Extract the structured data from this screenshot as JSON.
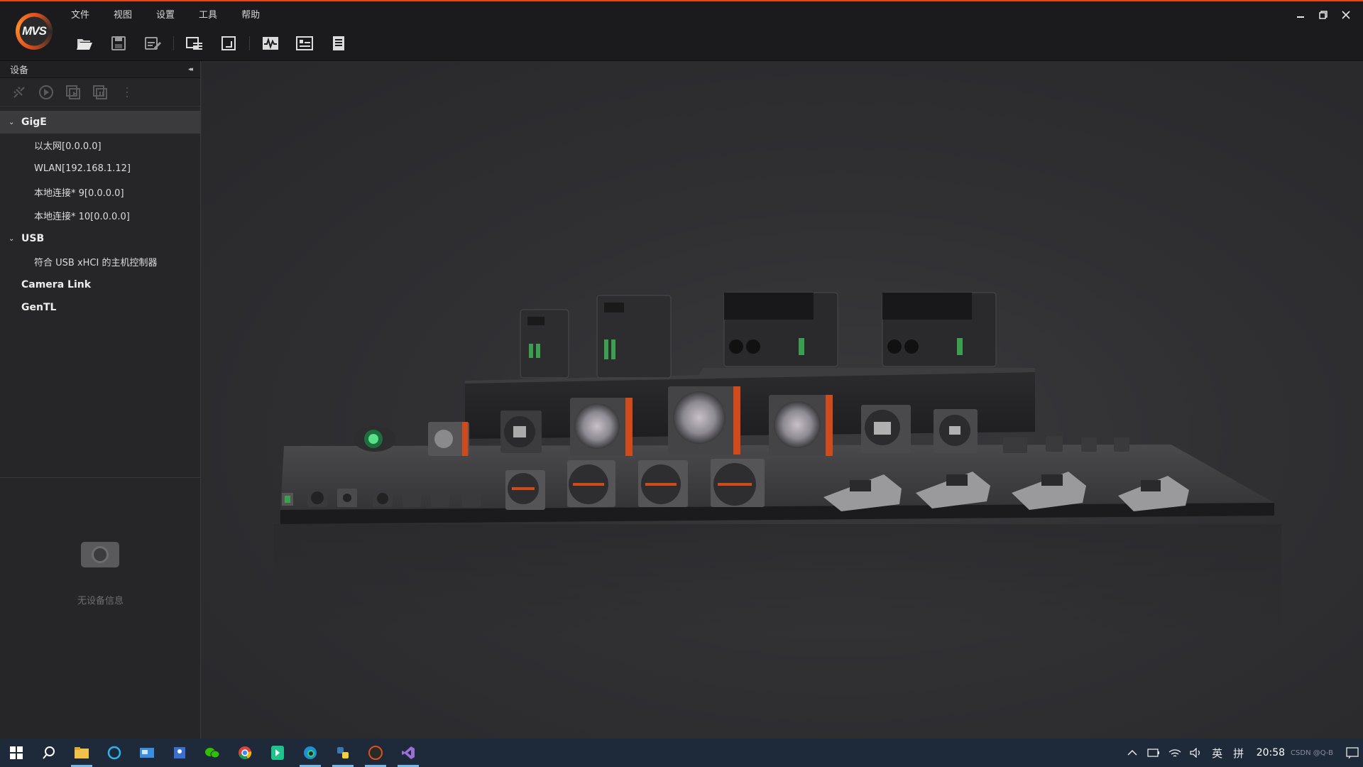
{
  "app": {
    "logo_text": "MVS",
    "accent_color": "#e04a1a"
  },
  "menu": {
    "items": [
      "文件",
      "视图",
      "设置",
      "工具",
      "帮助"
    ]
  },
  "toolbar": {
    "icons": [
      "open-folder-icon",
      "save-icon",
      "save-as-icon",
      "device-list-icon",
      "fullscreen-icon",
      "waveform-icon",
      "property-icon",
      "log-icon"
    ]
  },
  "sidebar": {
    "title": "设备",
    "collapse_glyph": "◂◂",
    "groups": [
      {
        "label": "GigE",
        "leaves": [
          "以太网[0.0.0.0]",
          "WLAN[192.168.1.12]",
          "本地连接* 9[0.0.0.0]",
          "本地连接* 10[0.0.0.0]"
        ]
      },
      {
        "label": "USB",
        "leaves": [
          "符合 USB xHCI 的主机控制器"
        ]
      },
      {
        "label": "Camera Link",
        "leaves": []
      },
      {
        "label": "GenTL",
        "leaves": []
      }
    ],
    "info_text": "无设备信息"
  },
  "taskbar": {
    "ime": "英",
    "ime_mode": "拼",
    "clock": "20:58",
    "watermark": "CSDN @Q-B"
  }
}
